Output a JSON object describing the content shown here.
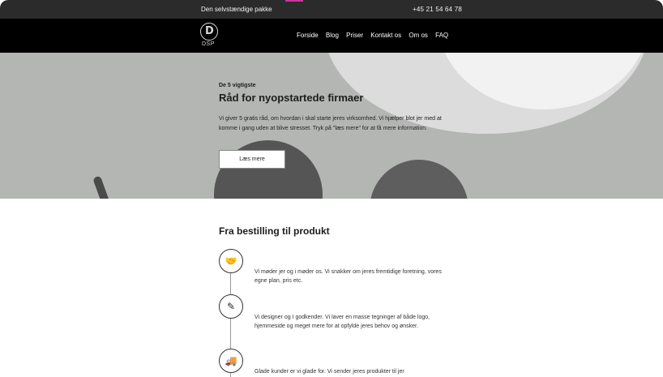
{
  "topbar": {
    "left": "Den selvstændige pakke",
    "right": "+45 21 54 64 78"
  },
  "nav": {
    "logo_text": "DSP",
    "logo_letter": "D",
    "items": [
      "Forside",
      "Blog",
      "Priser",
      "Kontakt os",
      "Om os",
      "FAQ"
    ]
  },
  "hero": {
    "kicker": "De 5 vigtigste",
    "title": "Råd for nyopstartede firmaer",
    "body": "Vi giver 5 gratis råd, om hvordan i skal starte jeres virksomhed. Vi hjælper blot jer med at komme i gang uden at blive stresset. Tryk på \"læs mere\" for at få mere information.",
    "button": "Læs mere"
  },
  "process": {
    "title": "Fra bestilling til produkt",
    "steps": [
      {
        "icon": "handshake-icon",
        "text": "Vi møder jer og i møder os. Vi snakker om jeres fremtidige foretning, vores egne plan, pris etc."
      },
      {
        "icon": "compass-icon",
        "text": "Vi designer og I godkender. Vi laver en masse tegninger af både logo, hjemmeside og meget mere for at opfylde jeres behov og ønsker."
      },
      {
        "icon": "truck-icon",
        "text": "Glade kunder er vi glade for. Vi sender jeres produkter til jer"
      }
    ]
  }
}
